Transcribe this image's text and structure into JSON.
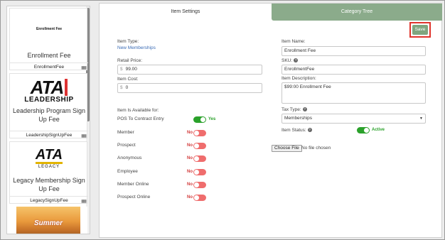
{
  "products": [
    {
      "name": "Enrollment Fee",
      "sku": "EnrollmentFee",
      "image_text": "Enrollment Fee"
    },
    {
      "name": "Leadership Program Sign Up Fee",
      "sku": "LeadershipSignUpFee",
      "logo": {
        "mark": "ATA",
        "sub": "LEADERSHIP"
      }
    },
    {
      "name": "Legacy Membership Sign Up Fee",
      "sku": "LegacySignUpFee",
      "logo": {
        "mark": "ATA",
        "sub": "LEGACY"
      }
    },
    {
      "name": "",
      "sku": "",
      "image_text": "Summer"
    }
  ],
  "tabs": {
    "settings": "Item Settings",
    "category_tree": "Category Tree"
  },
  "save_label": "Save",
  "form": {
    "item_type_label": "Item Type:",
    "item_type_value": "New Memberships",
    "retail_price_label": "Retail Price:",
    "retail_price_value": "99.00",
    "currency": "$",
    "item_cost_label": "Item Cost:",
    "item_cost_value": "0",
    "item_name_label": "Item Name:",
    "item_name_value": "Enrollment Fee",
    "sku_label": "SKU:",
    "sku_value": "EnrollmentFee",
    "description_label": "Item Description:",
    "description_value": "$99:00 Enrollment Fee",
    "tax_type_label": "Tax Type:",
    "tax_type_value": "Memberships",
    "item_status_label": "Item Status:",
    "item_status_value": "Active",
    "choose_file_label": "Choose File",
    "no_file_label": "No file chosen",
    "available_label": "Item Is Available for:",
    "yes": "Yes",
    "no": "No",
    "availability": [
      {
        "label": "POS To Contract Entry",
        "on": true
      },
      {
        "label": "Member",
        "on": false
      },
      {
        "label": "Prospect",
        "on": false
      },
      {
        "label": "Anonymous",
        "on": false
      },
      {
        "label": "Employee",
        "on": false
      },
      {
        "label": "Member Online",
        "on": false
      },
      {
        "label": "Prospect Online",
        "on": false
      }
    ]
  },
  "colors": {
    "accent_green": "#8bab8b",
    "toggle_on": "#2aa12a",
    "toggle_off": "#ef6d6d",
    "highlight": "#e0342c"
  }
}
